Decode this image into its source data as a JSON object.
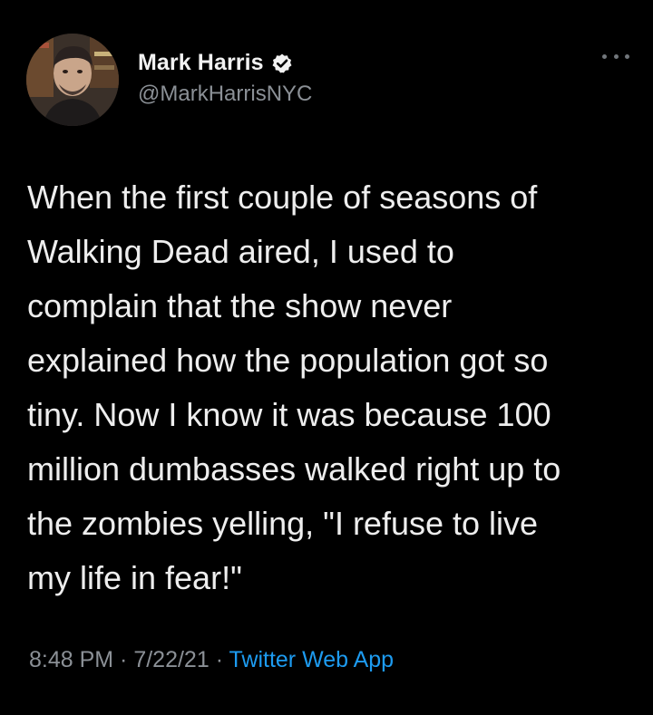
{
  "author": {
    "display_name": "Mark Harris",
    "handle": "@MarkHarrisNYC",
    "verified": true,
    "avatar_icon": "profile-photo"
  },
  "tweet": {
    "text": "When the first couple of seasons of\nWalking Dead aired, I used to\ncomplain that the show never\nexplained how the population got so\ntiny. Now I know it was because 100\nmillion dumbasses walked right up to\nthe zombies yelling, \"I refuse to live\nmy life in fear!\""
  },
  "meta": {
    "time": "8:48 PM",
    "separator": " · ",
    "date": "7/22/21",
    "source": "Twitter Web App"
  },
  "colors": {
    "background": "#000000",
    "text": "#e7e9ea",
    "secondary": "#8b9096",
    "accent": "#1d9bf0"
  },
  "icons": {
    "verified": "verified-badge-icon",
    "more": "more-options-icon"
  }
}
